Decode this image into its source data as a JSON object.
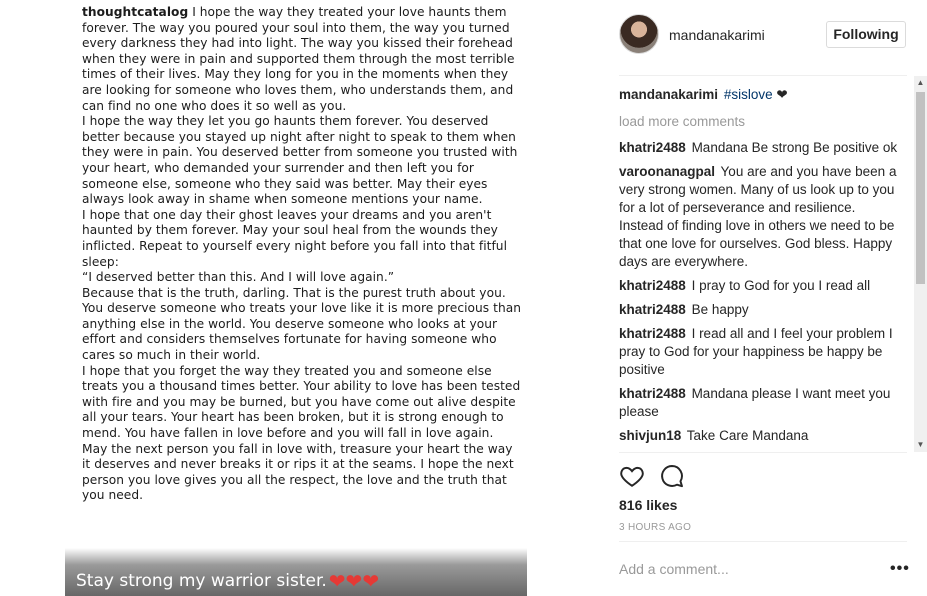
{
  "post": {
    "author": "thoughtcatalog",
    "paragraphs": [
      "I hope the way they treated your love haunts them forever. The way you poured your soul into them, the way you turned every darkness they had into light. The way you kissed their forehead when they were in pain and supported them through the most terrible times of their lives. May they long for you in the moments when they are looking for someone who loves them, who understands them, and can find no one who does it so well as you.",
      "I hope the way they let you go haunts them forever. You deserved better because you stayed up night after night to speak to them when they were in pain. You deserved better from someone you trusted with your heart, who demanded your surrender and then left you for someone else, someone who they said was better. May their eyes always look away in shame when someone mentions your name.",
      "I hope that one day their ghost leaves your dreams and you aren't haunted by them forever. May your soul heal from the wounds they inflicted. Repeat to yourself every night before you fall into that fitful sleep:",
      "“I deserved better than this. And I will love again.”",
      "Because that is the truth, darling. That is the purest truth about you. You deserve someone who treats your love like it is more precious than anything else in the world. You deserve someone who looks at your effort and considers themselves fortunate for having someone who cares so much in their world.",
      "I hope that you forget the way they treated you and someone else treats you a thousand times better. Your ability to love has been tested with fire and you may be burned, but you have come out alive despite all your tears. Your heart has been broken, but it is strong enough to mend. You have fallen in love before and you will fall in love again.",
      "May the next person you fall in love with, treasure your heart the way it deserves and never breaks it or rips it at the seams. I hope the next person you love gives you all the respect, the love and the truth that you need."
    ],
    "caption_overlay": "Stay strong my warrior sister."
  },
  "header": {
    "username": "mandanakarimi",
    "follow_label": "Following"
  },
  "caption": {
    "user": "mandanakarimi",
    "hashtag": "#sislove",
    "suffix": " ❤"
  },
  "load_more": "load more comments",
  "comments": [
    {
      "user": "khatri2488",
      "text": "Mandana Be strong Be positive ok"
    },
    {
      "user": "varoonanagpal",
      "text": "You are and you have been a very strong women. Many of us look up to you for a lot of perseverance and resilience. Instead of finding love in others we need to be that one love for ourselves. God bless. Happy days are everywhere."
    },
    {
      "user": "khatri2488",
      "text": "I pray to God for you I read all"
    },
    {
      "user": "khatri2488",
      "text": "Be happy"
    },
    {
      "user": "khatri2488",
      "text": "I read all and I feel your problem I pray to God for your happiness be happy be positive"
    },
    {
      "user": "khatri2488",
      "text": "Mandana please I want meet you please"
    },
    {
      "user": "shivjun18",
      "text": "Take Care Mandana"
    }
  ],
  "likes": "816 likes",
  "time": "3 HOURS AGO",
  "add_comment_placeholder": "Add a comment...",
  "more_label": "•••",
  "icons": [
    "heart-icon",
    "comment-icon",
    "more-options-icon",
    "scroll-up-arrow",
    "scroll-down-arrow"
  ],
  "colors": {
    "link": "#003569",
    "muted": "#999999",
    "text": "#262626",
    "heart": "#e53935"
  }
}
